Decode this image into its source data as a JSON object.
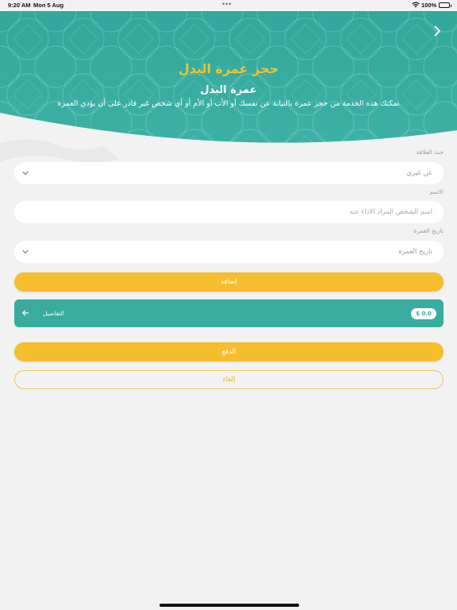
{
  "status_bar": {
    "time": "9:20 AM",
    "date": "Mon 5 Aug",
    "dots": "•••",
    "battery": "100%"
  },
  "header": {
    "title": "حجز عمرة البدل",
    "service_title": "عمرة البدل",
    "description": "تمكنك هذه الخدمة من حجز عمرة بالنيابة عن نفسك أو الأب أو الأم أو أي شخص غير قادر على أن يؤدي العمرة"
  },
  "form": {
    "relation": {
      "label": "حدد العلاقة",
      "value": "عن غيري"
    },
    "name": {
      "label": "الاسم",
      "placeholder": "اسم الشخص المراد الاداء عنه"
    },
    "date": {
      "label": "تاريخ العمرة",
      "placeholder": "تاريخ العمرة"
    }
  },
  "buttons": {
    "add": "إضافة",
    "pay": "الدفع",
    "cancel": "إلغاء"
  },
  "details": {
    "label": "التفاصيل",
    "price": "$ 0.0"
  },
  "colors": {
    "teal": "#3aab9f",
    "yellow": "#f6be2c",
    "background": "#f2f2f2"
  }
}
